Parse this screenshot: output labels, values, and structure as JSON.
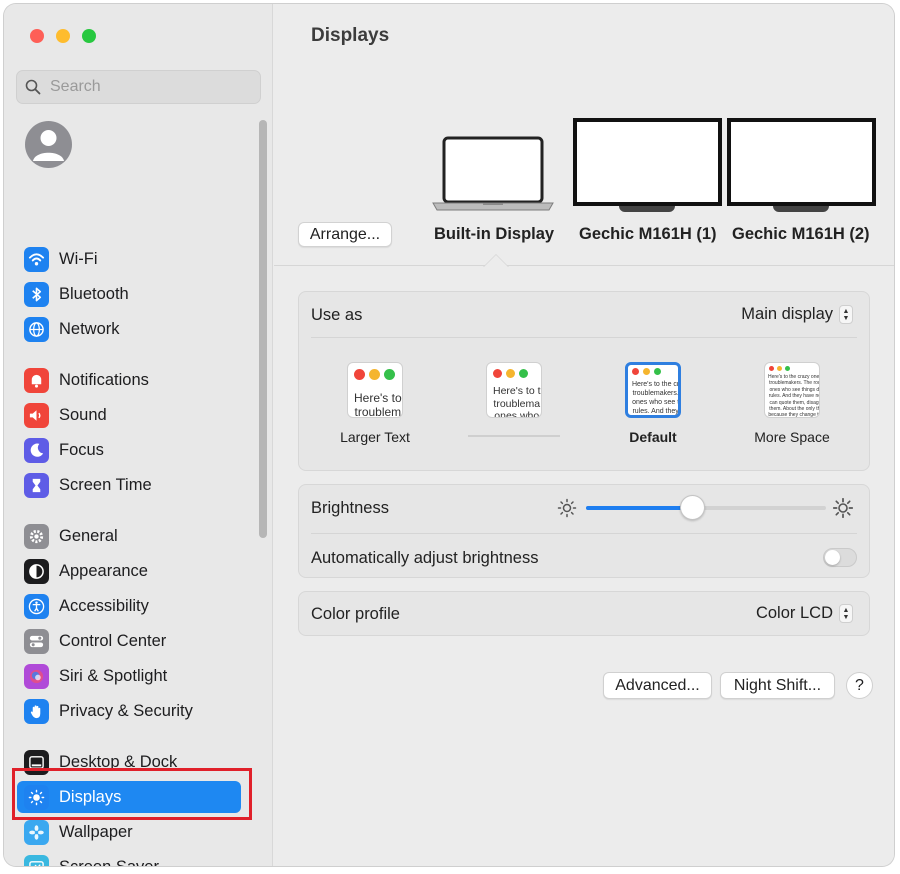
{
  "window": {
    "title": "Displays"
  },
  "search": {
    "placeholder": "Search"
  },
  "sidebar": {
    "items": [
      {
        "label": "Wi-Fi",
        "icon": "wifi-icon",
        "color": "#1e82f0"
      },
      {
        "label": "Bluetooth",
        "icon": "bluetooth-icon",
        "color": "#1e82f0"
      },
      {
        "label": "Network",
        "icon": "globe-icon",
        "color": "#1e82f0"
      },
      {
        "label": "Notifications",
        "icon": "bell-icon",
        "color": "#f0453a"
      },
      {
        "label": "Sound",
        "icon": "speaker-icon",
        "color": "#f0453a"
      },
      {
        "label": "Focus",
        "icon": "moon-icon",
        "color": "#5e5ce6"
      },
      {
        "label": "Screen Time",
        "icon": "hourglass-icon",
        "color": "#5e5ce6"
      },
      {
        "label": "General",
        "icon": "gear-icon",
        "color": "#8e8e93"
      },
      {
        "label": "Appearance",
        "icon": "appearance-icon",
        "color": "#1c1c1e"
      },
      {
        "label": "Accessibility",
        "icon": "accessibility-icon",
        "color": "#1e82f0"
      },
      {
        "label": "Control Center",
        "icon": "control-center-icon",
        "color": "#8e8e93"
      },
      {
        "label": "Siri & Spotlight",
        "icon": "siri-icon",
        "color": "#b04ad8"
      },
      {
        "label": "Privacy & Security",
        "icon": "hand-icon",
        "color": "#1e82f0"
      },
      {
        "label": "Desktop & Dock",
        "icon": "dock-icon",
        "color": "#1c1c1e"
      },
      {
        "label": "Displays",
        "icon": "sun-icon",
        "color": "#1e82f0",
        "selected": true
      },
      {
        "label": "Wallpaper",
        "icon": "flower-icon",
        "color": "#3aa8f0"
      },
      {
        "label": "Screen Saver",
        "icon": "screensaver-icon",
        "color": "#3ab8e0"
      }
    ]
  },
  "displays": {
    "arrange_label": "Arrange...",
    "items": [
      {
        "label": "Built-in Display",
        "selected": true
      },
      {
        "label": "Gechic M161H (1)"
      },
      {
        "label": "Gechic M161H (2)"
      }
    ]
  },
  "use_as": {
    "label": "Use as",
    "value": "Main display"
  },
  "resolution": {
    "options": [
      {
        "label": "Larger Text",
        "preview": "Here's to\ntroublem"
      },
      {
        "label": "",
        "preview": "Here's to t\ntroublema\nones who"
      },
      {
        "label": "Default",
        "preview": "Here's to the cr\ntroublemakers.\nones who see t\nrules. And they",
        "selected": true
      },
      {
        "label": "More Space",
        "preview": "Here's to the crazy ones\ntroublemakers. The rou\nones who see things di\nrules. And they have no\ncan quote them, disagr\nthem. About the only th\nbecause they change th"
      }
    ]
  },
  "brightness": {
    "label": "Brightness",
    "level": 0.44
  },
  "auto_brightness": {
    "label": "Automatically adjust brightness",
    "enabled": false
  },
  "color_profile": {
    "label": "Color profile",
    "value": "Color LCD"
  },
  "buttons": {
    "advanced": "Advanced...",
    "night_shift": "Night Shift...",
    "help": "?"
  },
  "colors": {
    "accent": "#1e7ef0",
    "highlight": "#e0202a"
  }
}
